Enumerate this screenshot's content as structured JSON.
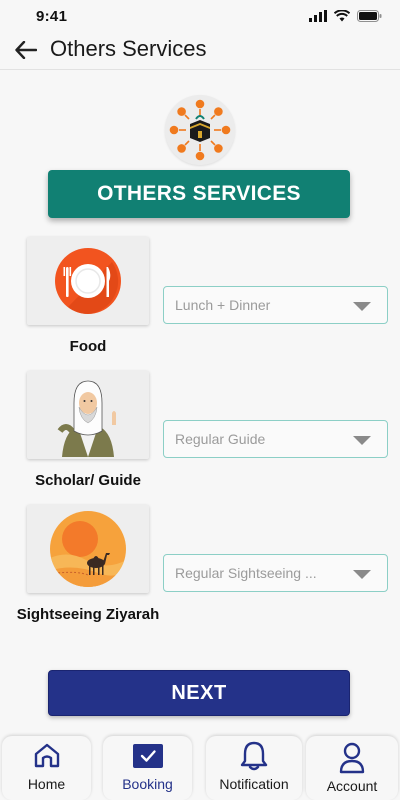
{
  "status_bar": {
    "time": "9:41"
  },
  "header": {
    "title": "Others Services"
  },
  "banner": {
    "title": "OTHERS SERVICES"
  },
  "services": [
    {
      "label": "Food",
      "selected": "Lunch + Dinner",
      "icon": "plate-icon"
    },
    {
      "label": "Scholar/ Guide",
      "selected": "Regular Guide",
      "icon": "scholar-icon"
    },
    {
      "label": "Sightseeing Ziyarah",
      "selected": "Regular Sightseeing ...",
      "icon": "camel-desert-icon"
    }
  ],
  "next_button": {
    "label": "NEXT"
  },
  "bottom_nav": [
    {
      "label": "Home",
      "icon": "home-icon"
    },
    {
      "label": "Booking",
      "icon": "checkbox-icon",
      "active": true
    },
    {
      "label": "Notification",
      "icon": "bell-icon"
    },
    {
      "label": "Account",
      "icon": "user-icon"
    }
  ],
  "colors": {
    "banner": "#118073",
    "next_button": "#243289",
    "select_border": "#8ccfc6",
    "accent_orange": "#f07a1e"
  }
}
